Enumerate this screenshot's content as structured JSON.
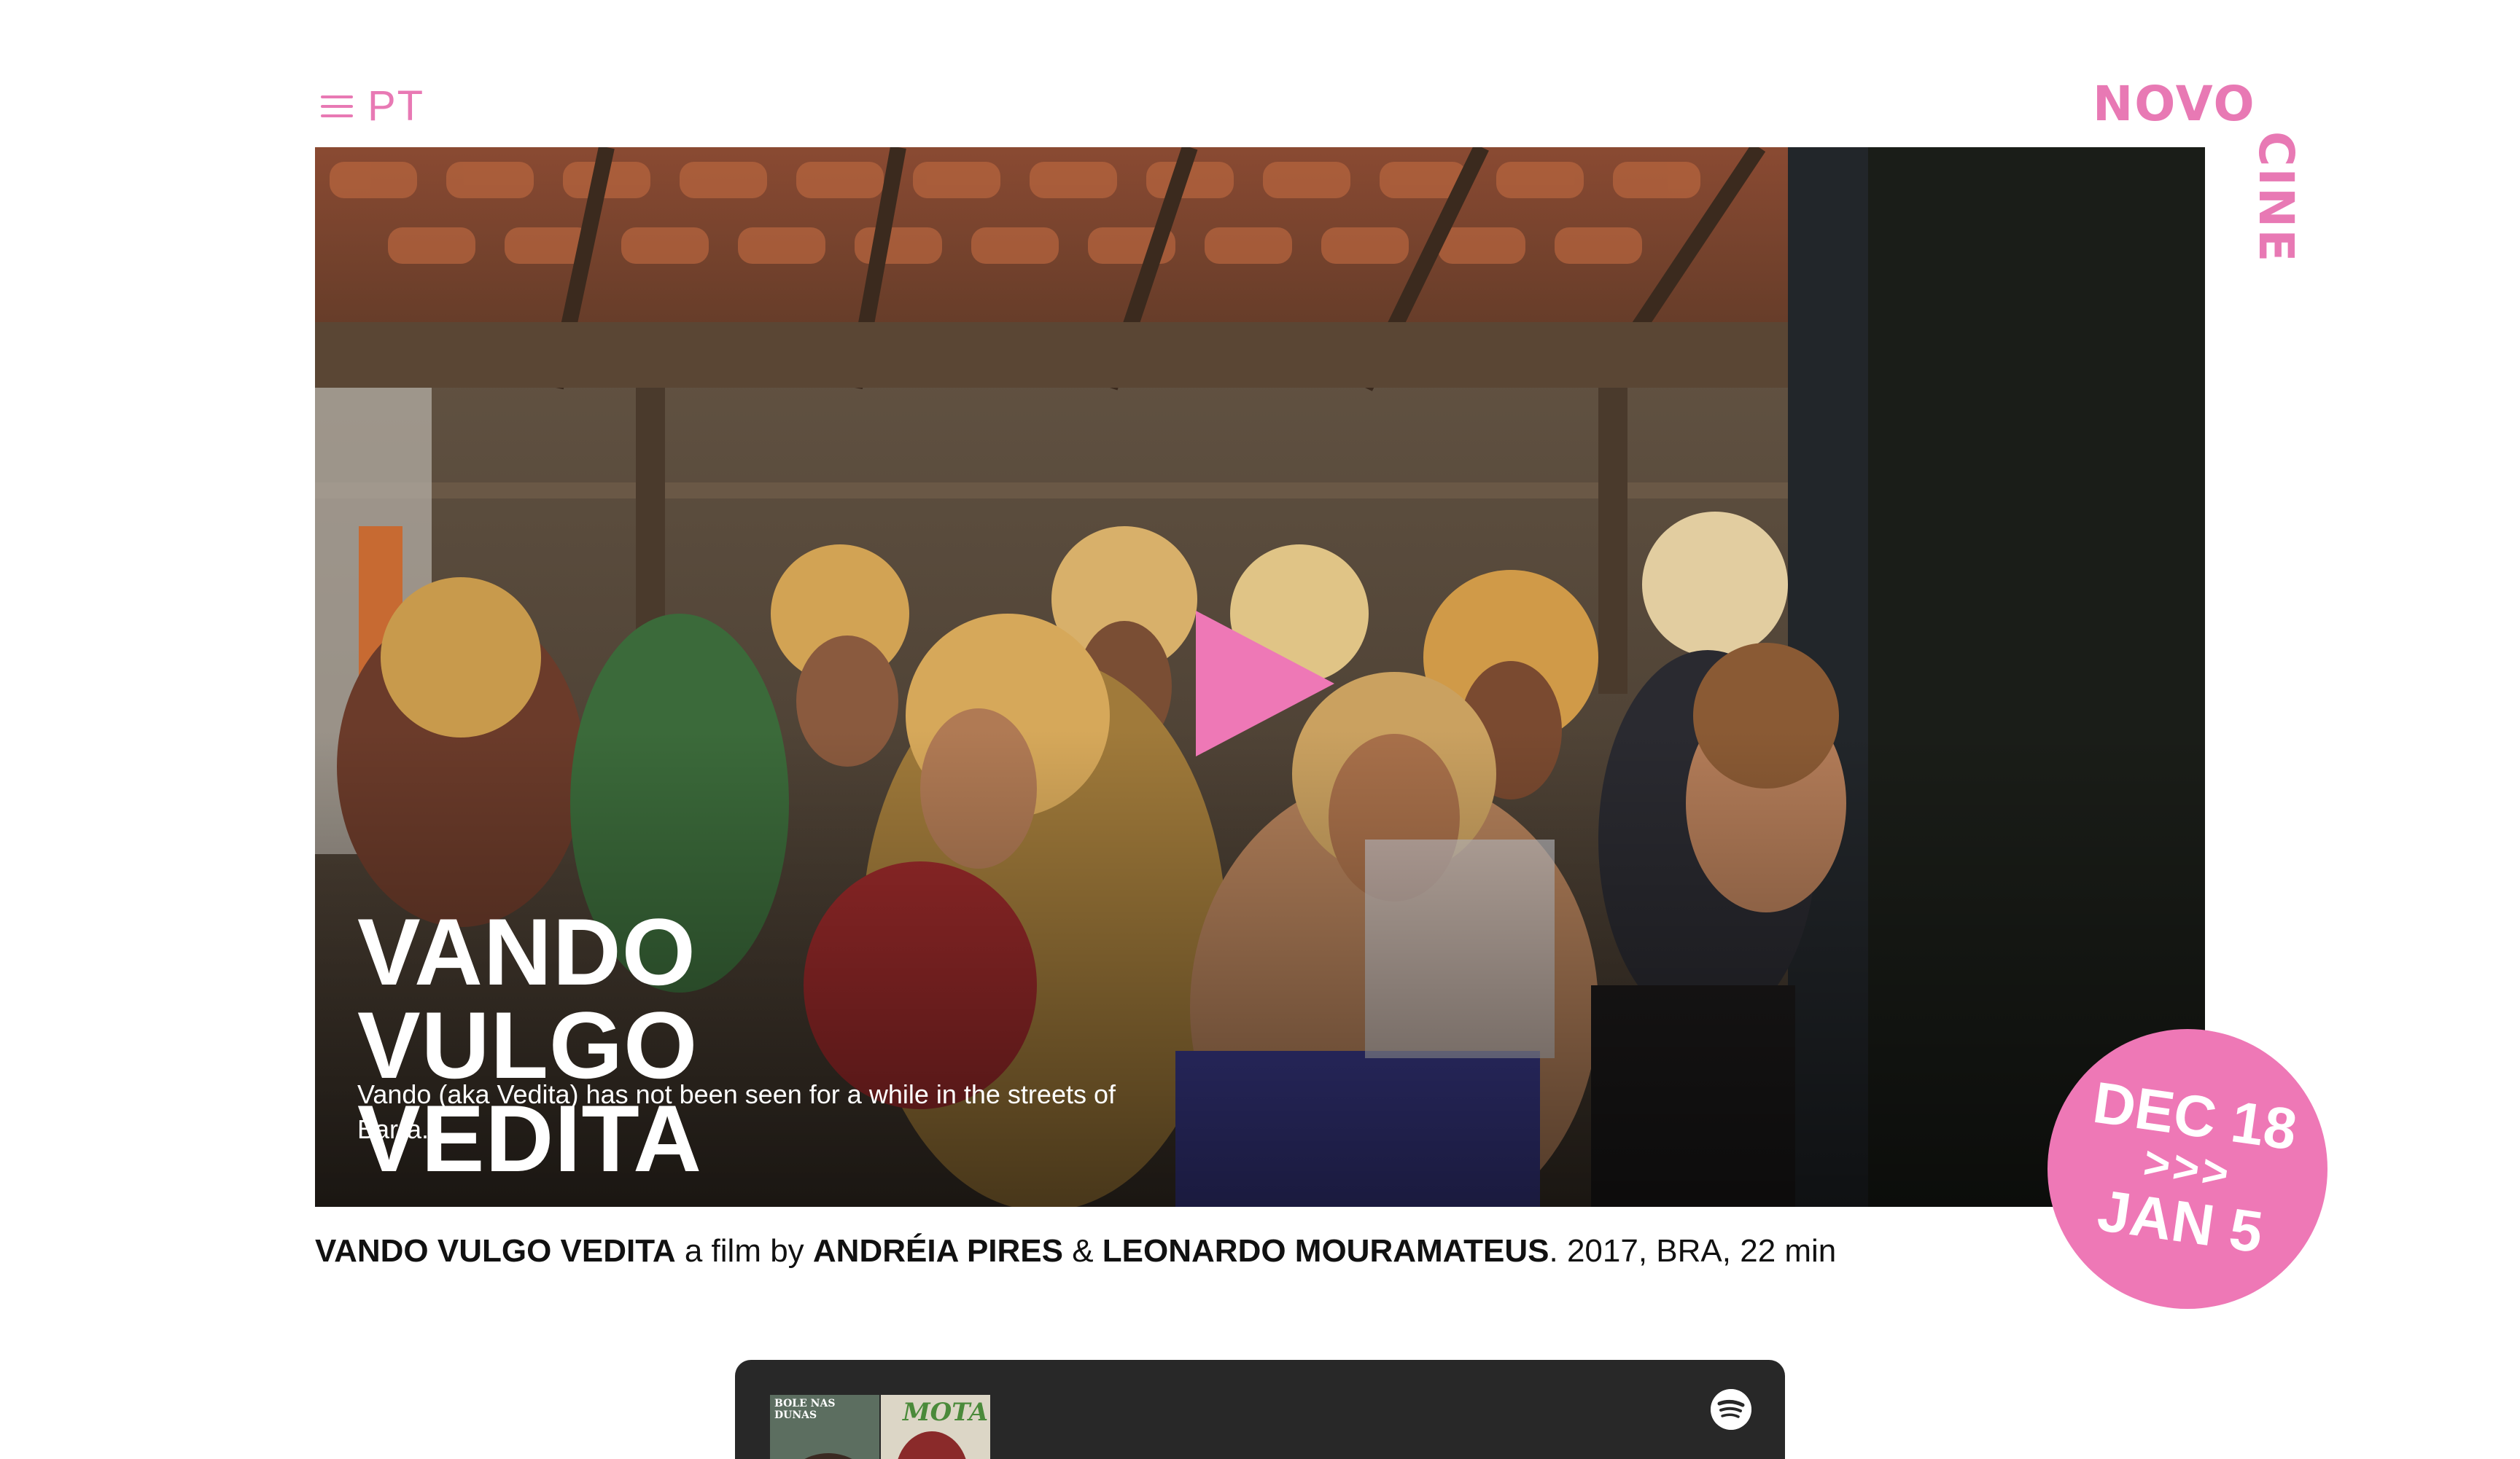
{
  "nav": {
    "language_label": "PT"
  },
  "logo": {
    "word1": "NOVO",
    "word2": "CINE"
  },
  "hero": {
    "title_lines": [
      "VANDO",
      "VULGO",
      "VEDITA"
    ],
    "description": "Vando (aka Vedita) has not been seen for a while in the streets of Barra."
  },
  "date_badge": {
    "start": "DEC 18",
    "arrows": ">>>",
    "end": "JAN 5"
  },
  "credits": {
    "title": "VANDO VULGO VEDITA",
    "by_text": " a film by ",
    "director1": "ANDRÉIA PIRES",
    "amp": " & ",
    "director2": "LEONARDO MOURAMATEUS",
    "details": ". 2017,  BRA, 22 min"
  },
  "embed": {
    "thumb1_text": "BOLE NAS DUNAS",
    "thumb2_text": "MOTA"
  },
  "colors": {
    "accent": "#e879b4",
    "badge": "#ee78b6",
    "embed_bg": "#282828"
  }
}
